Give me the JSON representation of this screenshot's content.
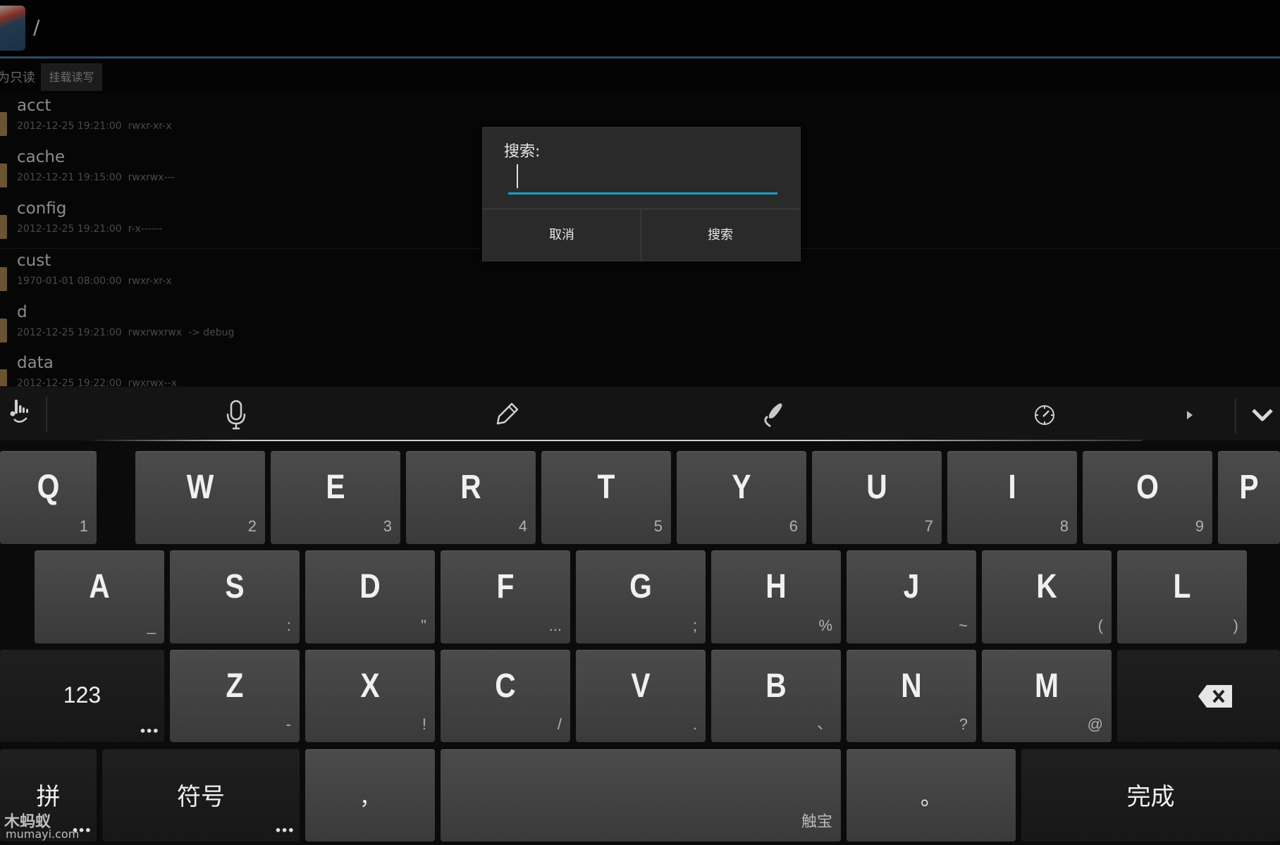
{
  "topbar": {
    "app_icon": "file-manager-app-icon",
    "path": "/"
  },
  "mount": {
    "readonly_label": "为只读",
    "mount_rw_button": "挂载读写"
  },
  "files": [
    {
      "name": "acct",
      "date": "2012-12-25 19:21:00",
      "perm": "rwxr-xr-x",
      "link": ""
    },
    {
      "name": "cache",
      "date": "2012-12-21 19:15:00",
      "perm": "rwxrwx---",
      "link": ""
    },
    {
      "name": "config",
      "date": "2012-12-25 19:21:00",
      "perm": "r-x------",
      "link": ""
    },
    {
      "name": "cust",
      "date": "1970-01-01 08:00:00",
      "perm": "rwxr-xr-x",
      "link": ""
    },
    {
      "name": "d",
      "date": "2012-12-25 19:21:00",
      "perm": "rwxrwxrwx",
      "link": "-> debug"
    },
    {
      "name": "data",
      "date": "2012-12-25 19:22:00",
      "perm": "rwxrwx--x",
      "link": ""
    }
  ],
  "dialog": {
    "title": "搜索:",
    "input_value": "",
    "cancel_label": "取消",
    "search_label": "搜索",
    "accent_color": "#1e9bc8"
  },
  "keyboard": {
    "toolbar": {
      "icons": [
        "gesture-hand-icon",
        "microphone-icon",
        "pencil-handwriting-icon",
        "swipe-hand-icon",
        "speed-gauge-icon",
        "play-arrow-icon",
        "collapse-chevron-icon"
      ]
    },
    "row1": [
      {
        "key": "Q",
        "sub": "1"
      },
      {
        "key": "W",
        "sub": "2"
      },
      {
        "key": "E",
        "sub": "3"
      },
      {
        "key": "R",
        "sub": "4"
      },
      {
        "key": "T",
        "sub": "5"
      },
      {
        "key": "Y",
        "sub": "6"
      },
      {
        "key": "U",
        "sub": "7"
      },
      {
        "key": "I",
        "sub": "8"
      },
      {
        "key": "O",
        "sub": "9"
      },
      {
        "key": "P",
        "sub": ""
      }
    ],
    "row2": [
      {
        "key": "A",
        "sub": "_"
      },
      {
        "key": "S",
        "sub": ":"
      },
      {
        "key": "D",
        "sub": "\""
      },
      {
        "key": "F",
        "sub": "..."
      },
      {
        "key": "G",
        "sub": ";"
      },
      {
        "key": "H",
        "sub": "%"
      },
      {
        "key": "J",
        "sub": "~"
      },
      {
        "key": "K",
        "sub": "("
      },
      {
        "key": "L",
        "sub": ")"
      }
    ],
    "row3": [
      {
        "key": "Z",
        "sub": "-"
      },
      {
        "key": "X",
        "sub": "!"
      },
      {
        "key": "C",
        "sub": "/"
      },
      {
        "key": "V",
        "sub": "."
      },
      {
        "key": "B",
        "sub": "、"
      },
      {
        "key": "N",
        "sub": "?"
      },
      {
        "key": "M",
        "sub": "@"
      }
    ],
    "numbers_key": "123",
    "more_dots": "•••",
    "pinyin_key": "拼",
    "symbols_key": "符号",
    "comma_key": "，",
    "space_brand": "触宝",
    "period_key": "。",
    "done_key": "完成"
  },
  "watermark": {
    "logo": "木蚂蚁",
    "site": "mumayi.com"
  }
}
